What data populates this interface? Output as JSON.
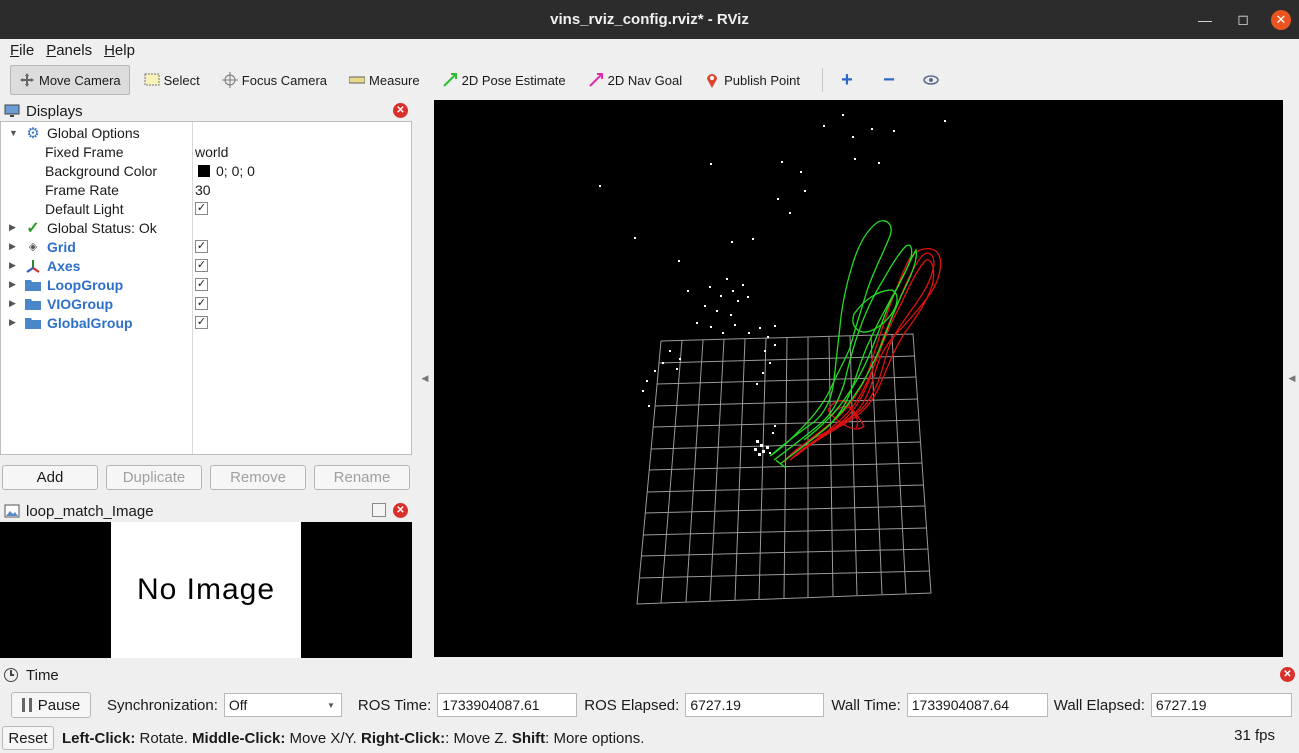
{
  "window": {
    "title": "vins_rviz_config.rviz* - RViz"
  },
  "menu": [
    {
      "label": "File",
      "u": "F",
      "rest": "ile"
    },
    {
      "label": "Panels",
      "u": "P",
      "rest": "anels"
    },
    {
      "label": "Help",
      "u": "H",
      "rest": "elp"
    }
  ],
  "toolbar": {
    "move_camera": "Move Camera",
    "select": "Select",
    "focus_camera": "Focus Camera",
    "measure": "Measure",
    "pose_estimate": "2D Pose Estimate",
    "nav_goal": "2D Nav Goal",
    "publish_point": "Publish Point"
  },
  "displays": {
    "title": "Displays",
    "global_options": "Global Options",
    "fixed_frame_label": "Fixed Frame",
    "fixed_frame_value": "world",
    "background_color_label": "Background Color",
    "background_color_value": "0; 0; 0",
    "background_color_hex": "#000000",
    "frame_rate_label": "Frame Rate",
    "frame_rate_value": "30",
    "default_light_label": "Default Light",
    "global_status": "Global Status: Ok",
    "items": [
      "Grid",
      "Axes",
      "LoopGroup",
      "VIOGroup",
      "GlobalGroup"
    ],
    "buttons": {
      "add": "Add",
      "duplicate": "Duplicate",
      "remove": "Remove",
      "rename": "Rename"
    }
  },
  "image_panel": {
    "title": "loop_match_Image",
    "placeholder": "No Image"
  },
  "time": {
    "title": "Time",
    "pause": "Pause",
    "sync_label": "Synchronization:",
    "sync_value": "Off",
    "ros_time_label": "ROS Time:",
    "ros_time": "1733904087.61",
    "ros_elapsed_label": "ROS Elapsed:",
    "ros_elapsed": "6727.19",
    "wall_time_label": "Wall Time:",
    "wall_time": "1733904087.64",
    "wall_elapsed_label": "Wall Elapsed:",
    "wall_elapsed": "6727.19"
  },
  "status": {
    "reset": "Reset",
    "left_click": "Left-Click:",
    "left_click_desc": " Rotate. ",
    "middle_click": "Middle-Click:",
    "middle_click_desc": " Move X/Y. ",
    "right_click": "Right-Click:",
    "right_click_desc": ": Move Z. ",
    "shift": "Shift",
    "shift_desc": ": More options.",
    "fps": "31 fps"
  },
  "colors": {
    "accent": "#e95420",
    "trajectory_green": "#22dd22",
    "trajectory_red": "#dd1111",
    "grid": "#9a9a9a"
  }
}
